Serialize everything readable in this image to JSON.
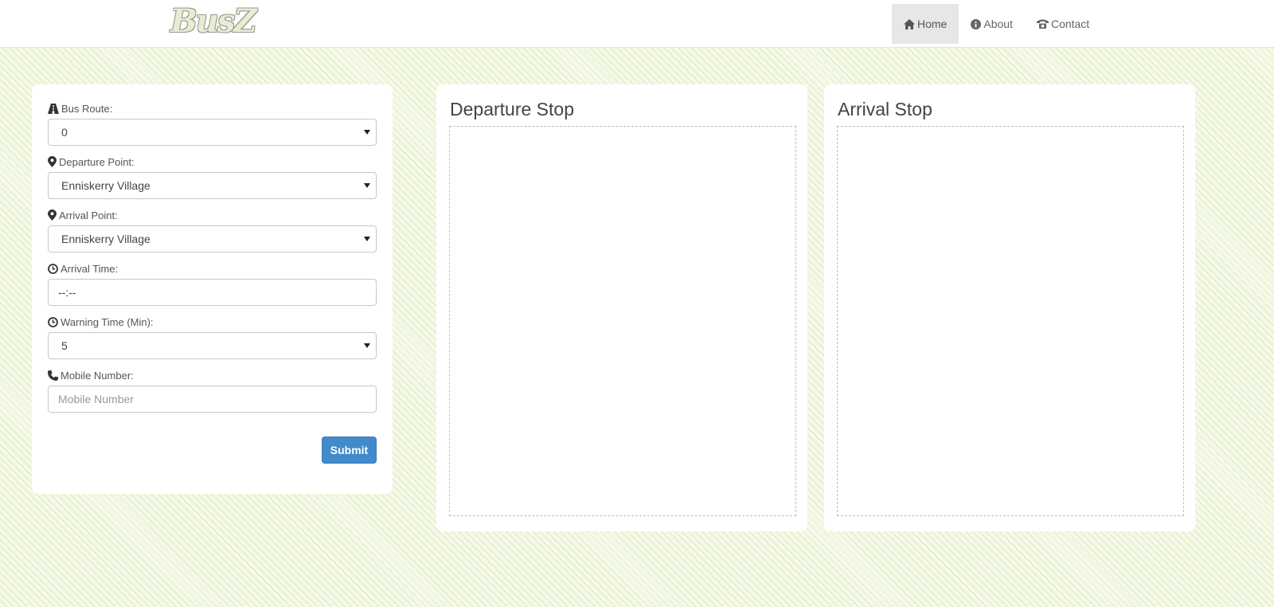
{
  "brand": {
    "logo_text": "BusZ"
  },
  "nav": {
    "items": [
      {
        "label": "Home",
        "icon": "home-icon",
        "active": true
      },
      {
        "label": "About",
        "icon": "info-icon",
        "active": false
      },
      {
        "label": "Contact",
        "icon": "phone-icon",
        "active": false
      }
    ]
  },
  "form": {
    "bus_route": {
      "label": "Bus Route:",
      "value": "0",
      "icon": "road-icon"
    },
    "departure_point": {
      "label": "Departure Point:",
      "value": "Enniskerry Village",
      "icon": "map-marker-icon"
    },
    "arrival_point": {
      "label": "Arrival Point:",
      "value": "Enniskerry Village",
      "icon": "map-marker-icon"
    },
    "arrival_time": {
      "label": "Arrival Time:",
      "value": "--:--",
      "icon": "clock-icon"
    },
    "warning_time": {
      "label": "Warning Time (Min):",
      "value": "5",
      "icon": "clock-icon"
    },
    "mobile_number": {
      "label": "Mobile Number:",
      "placeholder": "Mobile Number",
      "icon": "phone-icon"
    },
    "submit_label": "Submit"
  },
  "departure_panel": {
    "title": "Departure Stop"
  },
  "arrival_panel": {
    "title": "Arrival Stop"
  },
  "colors": {
    "primary_button": "#428bca",
    "nav_active_bg": "#e7e7e7"
  }
}
